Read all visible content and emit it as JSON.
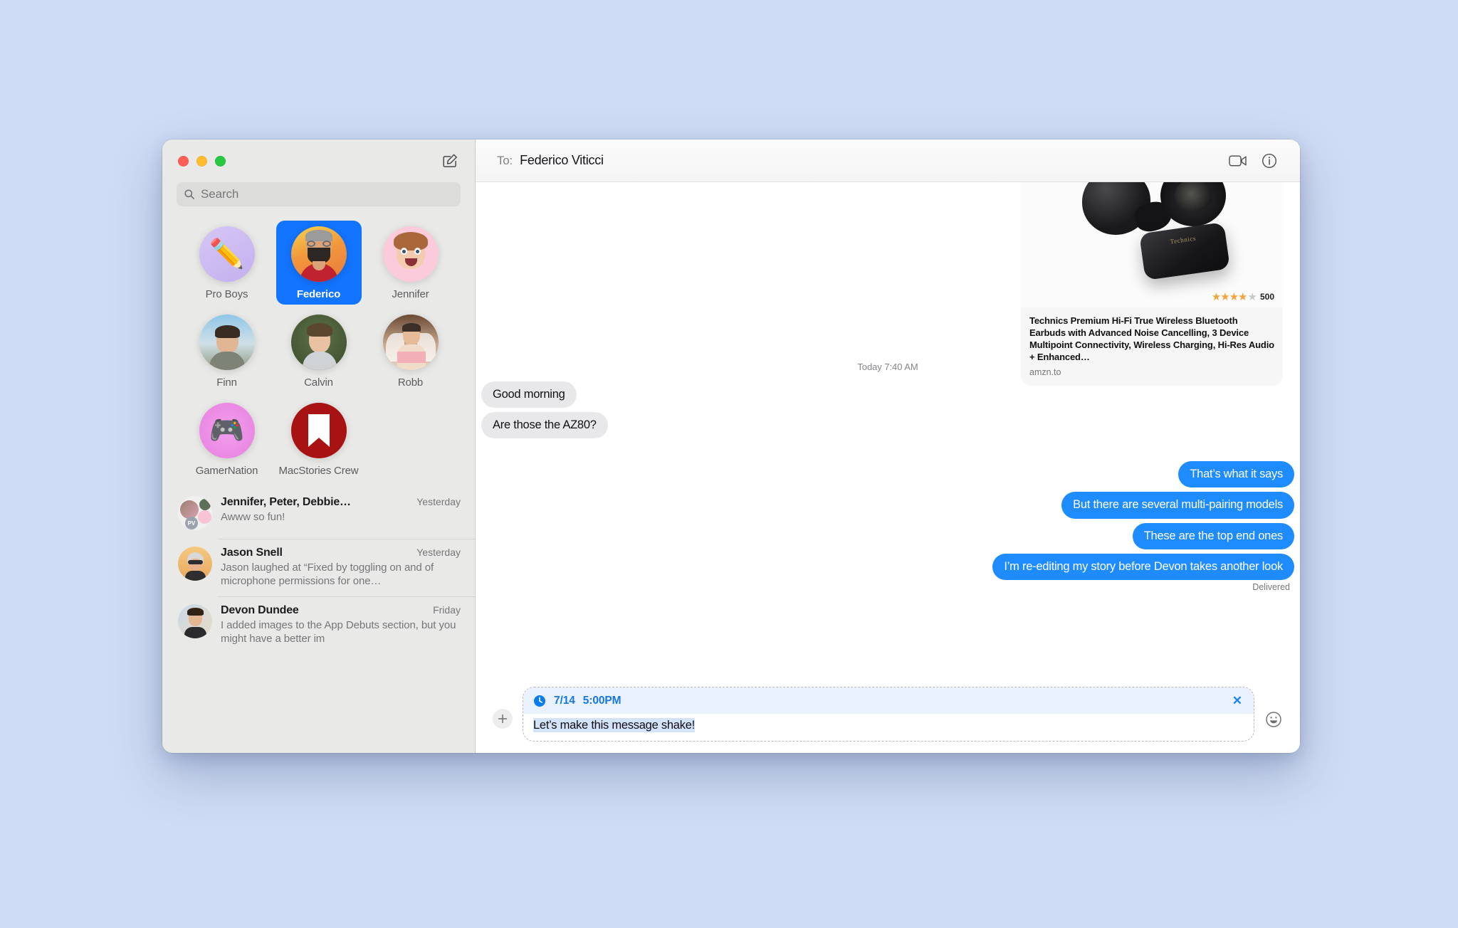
{
  "window": {
    "traffic_lights": [
      "close",
      "minimize",
      "zoom"
    ],
    "compose_icon": "compose-icon"
  },
  "sidebar": {
    "search": {
      "placeholder": "Search",
      "icon": "search-icon"
    },
    "pinned": [
      {
        "label": "Pro Boys",
        "kind": "emoji",
        "glyph": "✏️",
        "bg": "#cdbdf0",
        "selected": false
      },
      {
        "label": "Federico",
        "kind": "photo",
        "glyph": "",
        "bg": "#f2a93b",
        "selected": true
      },
      {
        "label": "Jennifer",
        "kind": "memoji",
        "glyph": "",
        "bg": "#f9c8d8",
        "selected": false
      },
      {
        "label": "Finn",
        "kind": "photo",
        "glyph": "",
        "bg": "#8fb7d4",
        "selected": false
      },
      {
        "label": "Calvin",
        "kind": "photo",
        "glyph": "",
        "bg": "#4d5f3b",
        "selected": false
      },
      {
        "label": "Robb",
        "kind": "photo",
        "glyph": "",
        "bg": "#c9a389",
        "selected": false
      },
      {
        "label": "GamerNation",
        "kind": "emoji",
        "glyph": "🎮",
        "bg": "#ef8fe8",
        "selected": false
      },
      {
        "label": "MacStories Crew",
        "kind": "mark",
        "glyph": "",
        "bg": "#a81212",
        "selected": false
      }
    ],
    "conversations": [
      {
        "name": "Jennifer, Peter, Debbie…",
        "time": "Yesterday",
        "preview": "Awww so fun!",
        "avatar": "group-avatar"
      },
      {
        "name": "Jason Snell",
        "time": "Yesterday",
        "preview": "Jason laughed at “Fixed by toggling on and of microphone permissions for one…",
        "avatar": "person-avatar"
      },
      {
        "name": "Devon Dundee",
        "time": "Friday",
        "preview": "I added images to the App Debuts section, but you might have a better im",
        "avatar": "person-avatar"
      }
    ]
  },
  "chat": {
    "to_label": "To:",
    "recipient": "Federico Viticci",
    "header_icons": [
      {
        "name": "facetime-video-icon"
      },
      {
        "name": "info-icon"
      }
    ],
    "link_preview": {
      "title": "Technics Premium Hi-Fi True Wireless Bluetooth Earbuds with Advanced Noise Cancelling, 3 Device Multipoint Connectivity, Wireless Charging, Hi-Res Audio + Enhanced…",
      "domain": "amzn.to",
      "rating_stars": "★★★★",
      "rating_half": "★",
      "rating_count": "500"
    },
    "timestamp": "Today 7:40 AM",
    "messages": [
      {
        "text": "Good morning",
        "dir": "in",
        "tail": false
      },
      {
        "text": "Are those the AZ80?",
        "dir": "in",
        "tail": true
      },
      {
        "text": "That’s what it says",
        "dir": "out",
        "tail": false
      },
      {
        "text": "But there are several multi-pairing models",
        "dir": "out",
        "tail": false
      },
      {
        "text": "These are the top end ones",
        "dir": "out",
        "tail": true
      },
      {
        "text": "I’m re-editing my story before Devon takes another look",
        "dir": "out",
        "tail": true
      }
    ],
    "delivered_label": "Delivered"
  },
  "compose": {
    "plus_label": "+",
    "attach_icon": "plus-icon",
    "scheduled": {
      "clock_icon": "clock-icon",
      "date": "7/14",
      "time": "5:00PM",
      "clear_label": "✕",
      "clear_icon": "close-icon"
    },
    "draft_text": "Let’s make this message shake!",
    "emoji_icon": "emoji-smiley-icon"
  },
  "colors": {
    "accent_blue": "#1e8bff",
    "pin_selected": "#1274ff",
    "incoming_bubble": "#e8e8ea",
    "sidebar_bg": "#e9e9e7",
    "desktop_bg": "#cfdcf5",
    "scheduled_strip": "#e9f2fe",
    "draft_highlight": "#d5e3fa"
  }
}
